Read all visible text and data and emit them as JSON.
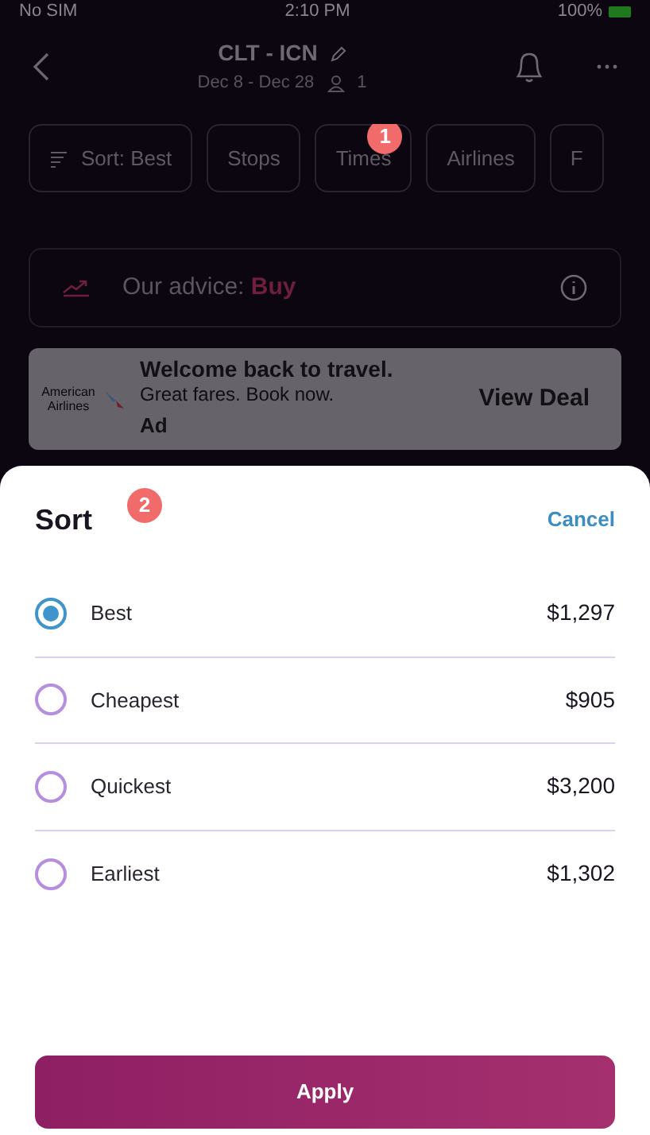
{
  "status_bar": {
    "carrier": "No SIM",
    "time": "2:10 PM",
    "battery": "100%"
  },
  "header": {
    "route": "CLT - ICN",
    "dates": "Dec 8 - Dec 28",
    "travelers": "1"
  },
  "filters": [
    {
      "label": "Sort: Best",
      "kind": "sort"
    },
    {
      "label": "Stops",
      "kind": "plain"
    },
    {
      "label": "Times",
      "kind": "plain",
      "badge": "1"
    },
    {
      "label": "Airlines",
      "kind": "plain"
    },
    {
      "label": "F",
      "kind": "plain"
    }
  ],
  "advice": {
    "label": "Our advice:",
    "value": "Buy"
  },
  "ad": {
    "logo_text": "American Airlines",
    "title": "Welcome back to travel.",
    "subtitle": "Great fares. Book now.",
    "tag": "Ad",
    "action": "View Deal"
  },
  "sheet": {
    "title": "Sort",
    "badge": "2",
    "cancel": "Cancel",
    "options": [
      {
        "label": "Best",
        "price": "$1,297",
        "selected": true
      },
      {
        "label": "Cheapest",
        "price": "$905",
        "selected": false
      },
      {
        "label": "Quickest",
        "price": "$3,200",
        "selected": false
      },
      {
        "label": "Earliest",
        "price": "$1,302",
        "selected": false
      }
    ],
    "apply": "Apply"
  }
}
